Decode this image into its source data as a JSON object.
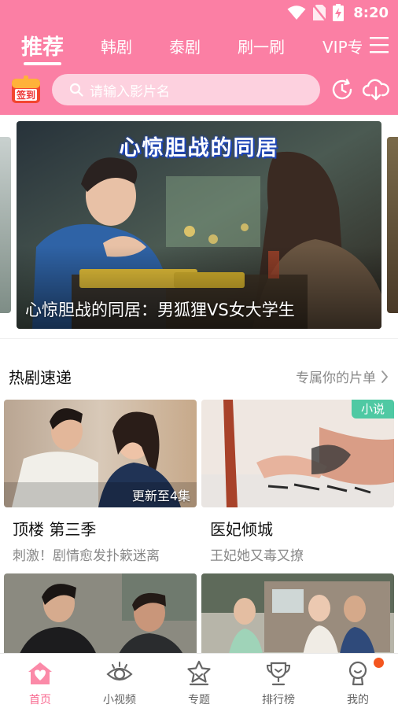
{
  "status_bar": {
    "time": "8:20"
  },
  "tabs": [
    {
      "label": "推荐",
      "active": true
    },
    {
      "label": "韩剧",
      "active": false
    },
    {
      "label": "泰剧",
      "active": false
    },
    {
      "label": "刷一刷",
      "active": false
    },
    {
      "label": "VIP专",
      "active": false
    }
  ],
  "search": {
    "placeholder": "请输入影片名"
  },
  "signin": {
    "label": "签到"
  },
  "banner": {
    "overlay_title": "心惊胆战的同居",
    "caption": "心惊胆战的同居：男狐狸VS女大学生"
  },
  "section": {
    "title": "热剧速递",
    "more": "专属你的片单"
  },
  "cards": [
    {
      "title": "顶楼 第三季",
      "subtitle": "刺激！剧情愈发扑簌迷离",
      "tag": "更新至4集"
    },
    {
      "title": "医妃倾城",
      "subtitle": "王妃她又毒又撩",
      "badge": "小说"
    }
  ],
  "bottom_nav": [
    {
      "label": "首页",
      "icon": "home-icon",
      "active": true
    },
    {
      "label": "小视频",
      "icon": "eye-icon",
      "active": false
    },
    {
      "label": "专题",
      "icon": "star-icon",
      "active": false
    },
    {
      "label": "排行榜",
      "icon": "trophy-icon",
      "active": false
    },
    {
      "label": "我的",
      "icon": "profile-icon",
      "active": false
    }
  ],
  "colors": {
    "brand_pink": "#fb7fa4",
    "active_nav": "#f8688f",
    "novel_badge": "#4fc9a3",
    "notification_dot": "#f4561f"
  }
}
